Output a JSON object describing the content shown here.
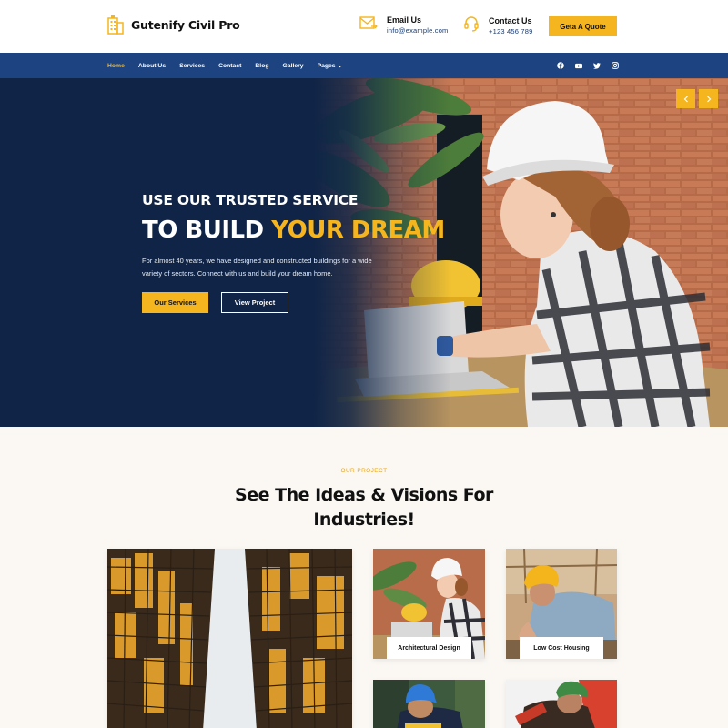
{
  "brand": {
    "name": "Gutenify Civil Pro",
    "accent": "#f5b51e",
    "navy": "#1d4480",
    "logo_icon": "building-icon"
  },
  "header": {
    "email": {
      "title": "Email Us",
      "value": "info@example.com",
      "icon": "mail-icon"
    },
    "phone": {
      "title": "Contact Us",
      "value": "+123 456 789",
      "icon": "headset-icon"
    },
    "quote_button": "Geta A Quote"
  },
  "nav": {
    "items": [
      "Home",
      "About Us",
      "Services",
      "Contact",
      "Blog",
      "Gallery",
      "Pages ⌄"
    ],
    "active": "Home",
    "social": [
      "facebook-icon",
      "youtube-icon",
      "twitter-icon",
      "instagram-icon"
    ]
  },
  "hero": {
    "subtitle": "USE OUR TRUSTED SERVICE",
    "title_prefix": "TO BUILD ",
    "title_highlight": "YOUR DREAM",
    "description": "For almost 40 years, we have designed and constructed buildings for a wide variety of sectors. Connect with us and build your dream home.",
    "primary_button": "Our Services",
    "secondary_button": "View Project",
    "prev_icon": "chevron-left-icon",
    "next_icon": "chevron-right-icon"
  },
  "projects": {
    "eyebrow": "OUR PROJECT",
    "title": "See The Ideas & Visions For Industries!",
    "cards": [
      {
        "label": ""
      },
      {
        "label": "Architectural Design"
      },
      {
        "label": "Low Cost Housing"
      },
      {
        "label": ""
      },
      {
        "label": ""
      }
    ]
  }
}
